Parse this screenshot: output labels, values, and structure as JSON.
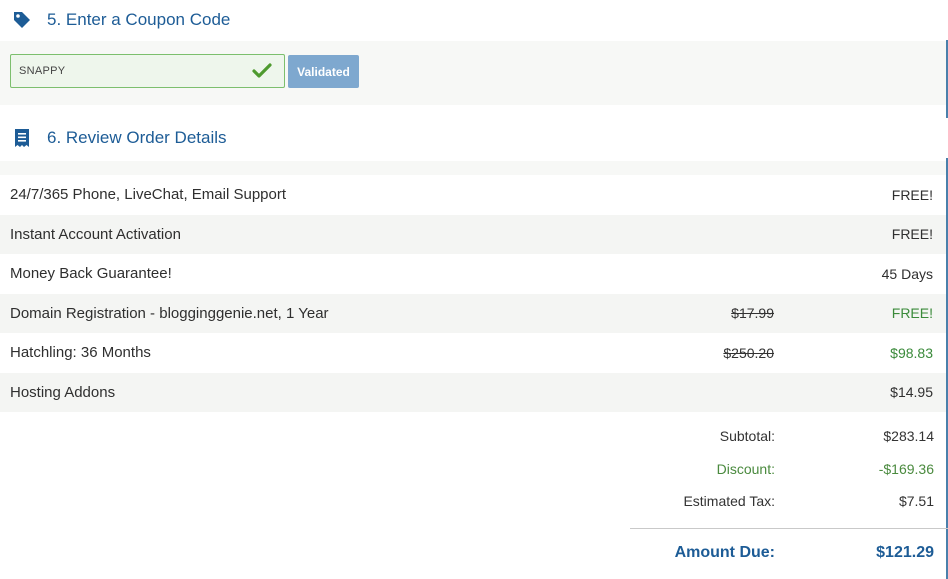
{
  "coupon_section": {
    "title": "5. Enter a Coupon Code",
    "icon": "tag-icon",
    "input_value": "SNAPPY",
    "validated_label": "Validated"
  },
  "review_section": {
    "title": "6. Review Order Details",
    "icon": "receipt-icon"
  },
  "order_items": [
    {
      "label": "24/7/365 Phone, LiveChat, Email Support",
      "original": "",
      "price": "FREE!"
    },
    {
      "label": "Instant Account Activation",
      "original": "",
      "price": "FREE!"
    },
    {
      "label": "Money Back Guarantee!",
      "original": "",
      "price": "45 Days"
    },
    {
      "label": "Domain Registration - blogginggenie.net, 1 Year",
      "original": "$17.99",
      "price": "FREE!"
    },
    {
      "label": "Hatchling: 36 Months",
      "original": "$250.20",
      "price": "$98.83"
    },
    {
      "label": "Hosting Addons",
      "original": "",
      "price": "$14.95"
    }
  ],
  "totals": {
    "subtotal_label": "Subtotal:",
    "subtotal_value": "$283.14",
    "discount_label": "Discount:",
    "discount_value": "-$169.36",
    "tax_label": "Estimated Tax:",
    "tax_value": "$7.51",
    "due_label": "Amount Due:",
    "due_value": "$121.29"
  },
  "colors": {
    "heading": "#1d5c96",
    "discount_green": "#3a8a3a",
    "validated_button": "#7ea8cf",
    "input_border": "#7cbf6d"
  }
}
